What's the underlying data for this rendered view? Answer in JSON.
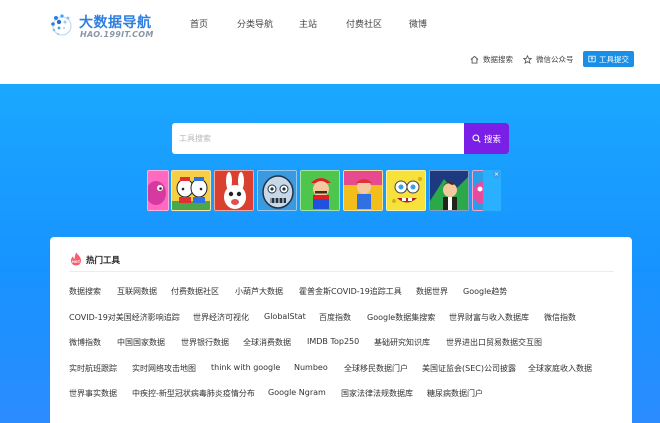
{
  "logo": {
    "title": "大数据导航",
    "subtitle": "HAO.199IT.COM"
  },
  "nav": {
    "items": [
      {
        "label": "首页",
        "name": "nav-item-home"
      },
      {
        "label": "分类导航",
        "name": "nav-item-category"
      },
      {
        "label": "主站",
        "name": "nav-item-main-site"
      },
      {
        "label": "付费社区",
        "name": "nav-item-paid-community"
      },
      {
        "label": "微博",
        "name": "nav-item-weibo"
      }
    ]
  },
  "toolbar": {
    "data_search": "数据搜索",
    "wechat": "微信公众号",
    "submit_tool": "工具提交"
  },
  "search": {
    "placeholder": "工具搜索",
    "button_label": "搜索"
  },
  "banner": {
    "tiles": [
      "game-tile-1",
      "game-tile-2",
      "game-tile-3",
      "game-tile-4",
      "game-tile-5",
      "game-tile-6",
      "game-tile-7",
      "game-tile-8",
      "game-tile-9"
    ]
  },
  "hot_tools": {
    "title": "热门工具",
    "badge": "HOT",
    "rows": [
      [
        "数据搜索",
        "互联网数据",
        "付费数据社区",
        "小葫芦大数据",
        "霍普金斯COVID-19追踪工具",
        "数据世界",
        "Google趋势"
      ],
      [
        "COVID-19对美国经济影响追踪",
        "世界经济可视化",
        "GlobalStat",
        "百度指数",
        "Google数据集搜索",
        "世界财富与收入数据库",
        "微信指数"
      ],
      [
        "微博指数",
        "中国国家数据",
        "世界银行数据",
        "全球消费数据",
        "IMDB Top250",
        "基础研究知识库",
        "世界进出口贸易数据交互图"
      ],
      [
        "实时航班跟踪",
        "实时网络攻击地图",
        "think with google",
        "Numbeo",
        "全球移民数据门户",
        "美国证监会(SEC)公司披露",
        "全球家庭收入数据"
      ],
      [
        "世界事实数据",
        "中疾控-新型冠状病毒肺炎疫情分布",
        "Google Ngram",
        "国家法律法规数据库",
        "糖尿病数据门户"
      ]
    ]
  },
  "colors": {
    "hero_blue": "#1793ff",
    "search_button": "#7a1fe6",
    "submit_button": "#1a8fe8",
    "hot_badge": "#ff5a6e"
  }
}
